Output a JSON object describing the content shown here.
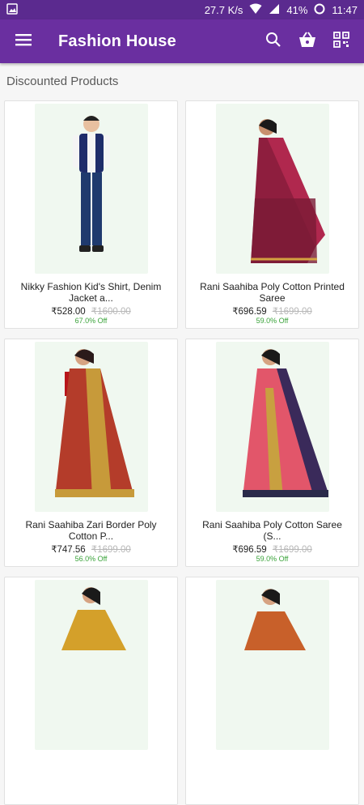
{
  "status_bar": {
    "speed": "27.7 K/s",
    "battery": "41%",
    "time": "11:47"
  },
  "app_bar": {
    "title": "Fashion House",
    "icons": [
      "menu-icon",
      "search-icon",
      "basket-icon",
      "qr-code-icon"
    ]
  },
  "section": {
    "title": "Discounted Products"
  },
  "products": [
    {
      "name": "Nikky Fashion Kid's Shirt, Denim Jacket a...",
      "price": "₹528.00",
      "mrp": "₹1600.00",
      "discount": "67.0% Off"
    },
    {
      "name": "Rani Saahiba Poly Cotton Printed Saree",
      "price": "₹696.59",
      "mrp": "₹1699.00",
      "discount": "59.0% Off"
    },
    {
      "name": "Rani Saahiba Zari Border Poly Cotton P...",
      "price": "₹747.56",
      "mrp": "₹1699.00",
      "discount": "56.0% Off"
    },
    {
      "name": "Rani Saahiba Poly Cotton Saree (S...",
      "price": "₹696.59",
      "mrp": "₹1699.00",
      "discount": "59.0% Off"
    },
    {
      "name": "",
      "price": "",
      "mrp": "",
      "discount": ""
    },
    {
      "name": "",
      "price": "",
      "mrp": "",
      "discount": ""
    }
  ],
  "colors": {
    "status_bar": "#5b2a8f",
    "app_bar": "#6a2fa0",
    "discount_green": "#3aa33a"
  }
}
